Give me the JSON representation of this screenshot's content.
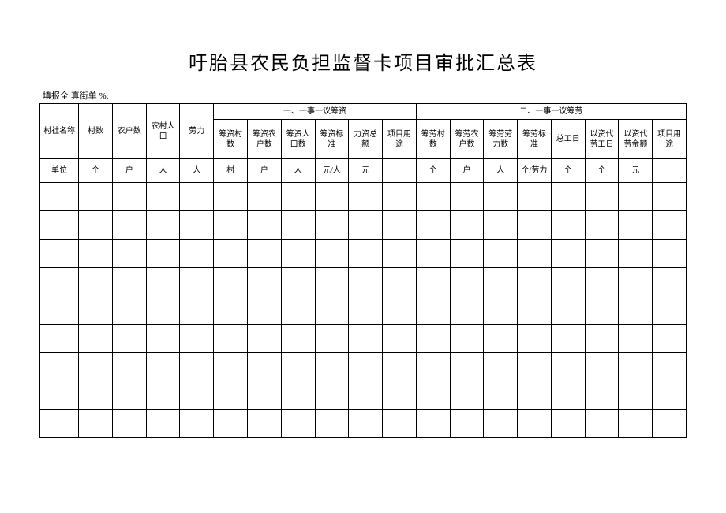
{
  "title": "吁胎县农民负担监督卡项目审批汇总表",
  "subheader": "填报全 真街单 %:",
  "groups": {
    "g1": "一、一事一议筹资",
    "g2": "二、一事一议筹劳"
  },
  "headers": {
    "c1": "村社名称",
    "c2": "村数",
    "c3": "农户数",
    "c4": "农村人口",
    "c5": "劳力",
    "c6": "筹资村数",
    "c7": "筹资农户数",
    "c8": "筹资人口数",
    "c9": "筹资标准",
    "c10": "力资总额",
    "c11": "项目用途",
    "c12": "筹劳村数",
    "c13": "筹劳农户数",
    "c14": "筹劳劳力数",
    "c15": "筹劳标准",
    "c16": "总工日",
    "c17": "以资代劳工日",
    "c18": "以资代劳金额",
    "c19": "项目用途"
  },
  "unitRowLabel": "单位",
  "units": {
    "u2": "个",
    "u3": "户",
    "u4": "人",
    "u5": "人",
    "u6": "村",
    "u7": "户",
    "u8": "人",
    "u9": "元/人",
    "u10": "元",
    "u11": "",
    "u12": "个",
    "u13": "户",
    "u14": "人",
    "u15": "个/劳力",
    "u16": "个",
    "u17": "个",
    "u18": "元",
    "u19": ""
  }
}
